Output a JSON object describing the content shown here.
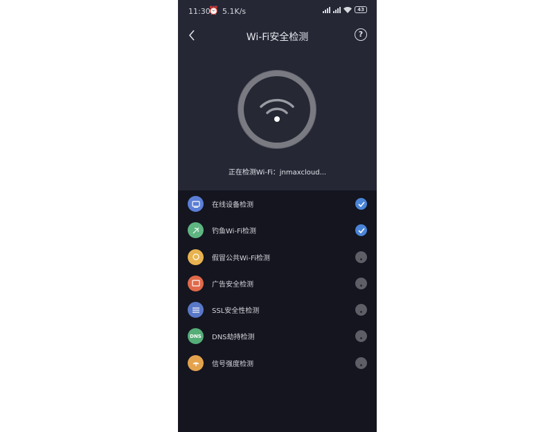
{
  "status_bar": {
    "time": "11:30",
    "speed": "5.1K/s",
    "battery": "43"
  },
  "header": {
    "title": "Wi-Fi安全检测",
    "help_label": "?"
  },
  "scan": {
    "text": "正在检测Wi-Fi：jnmaxcloud..."
  },
  "checks": [
    {
      "label": "在线设备检测",
      "icon": "device-icon",
      "color": "#5b7fd6",
      "done": true
    },
    {
      "label": "钓鱼Wi-Fi检测",
      "icon": "phishing-icon",
      "color": "#5fb582",
      "done": true
    },
    {
      "label": "假冒公共Wi-Fi检测",
      "icon": "fake-wifi-icon",
      "color": "#e8b34f",
      "done": false
    },
    {
      "label": "广告安全检测",
      "icon": "ad-icon",
      "color": "#e0694a",
      "done": false
    },
    {
      "label": "SSL安全性检测",
      "icon": "ssl-icon",
      "color": "#5a78c8",
      "done": false
    },
    {
      "label": "DNS劫持检测",
      "icon": "dns-icon",
      "icon_text": "DNS",
      "color": "#55ad77",
      "done": false
    },
    {
      "label": "信号强度检测",
      "icon": "signal-icon",
      "color": "#e3a34d",
      "done": false
    }
  ]
}
